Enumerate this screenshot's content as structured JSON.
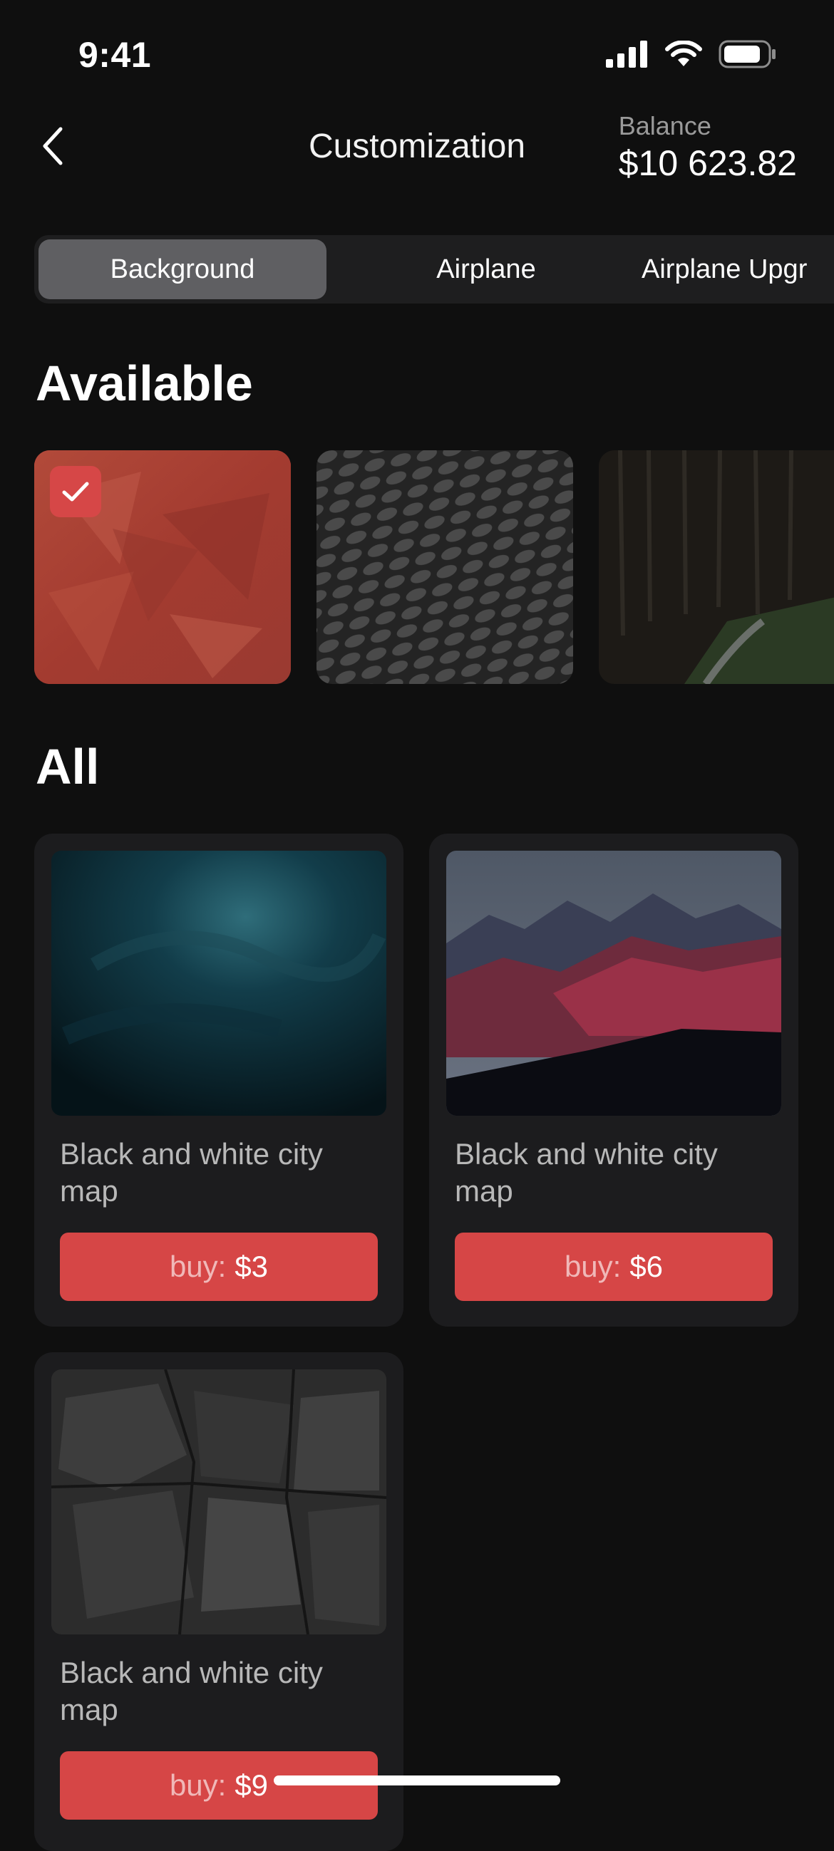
{
  "status_bar": {
    "time": "9:41"
  },
  "header": {
    "title": "Customization",
    "balance_label": "Balance",
    "balance_value": "$10 623.82"
  },
  "tabs": [
    {
      "label": "Background",
      "active": true
    },
    {
      "label": "Airplane",
      "active": false
    },
    {
      "label": "Airplane Upgr",
      "active": false
    }
  ],
  "available": {
    "heading": "Available",
    "items": [
      {
        "name": "red-texture",
        "selected": true
      },
      {
        "name": "dotted-pattern",
        "selected": false
      },
      {
        "name": "forest-path",
        "selected": false
      }
    ]
  },
  "all": {
    "heading": "All",
    "cards": [
      {
        "title": "Black and white city map",
        "buy_label": "buy:",
        "price": "$3"
      },
      {
        "title": "Black and white city map",
        "buy_label": "buy:",
        "price": "$6"
      },
      {
        "title": "Black and white city map",
        "buy_label": "buy:",
        "price": "$9"
      }
    ]
  },
  "colors": {
    "accent": "#d64646",
    "background": "#0f0f0f",
    "card": "#1c1c1e"
  }
}
